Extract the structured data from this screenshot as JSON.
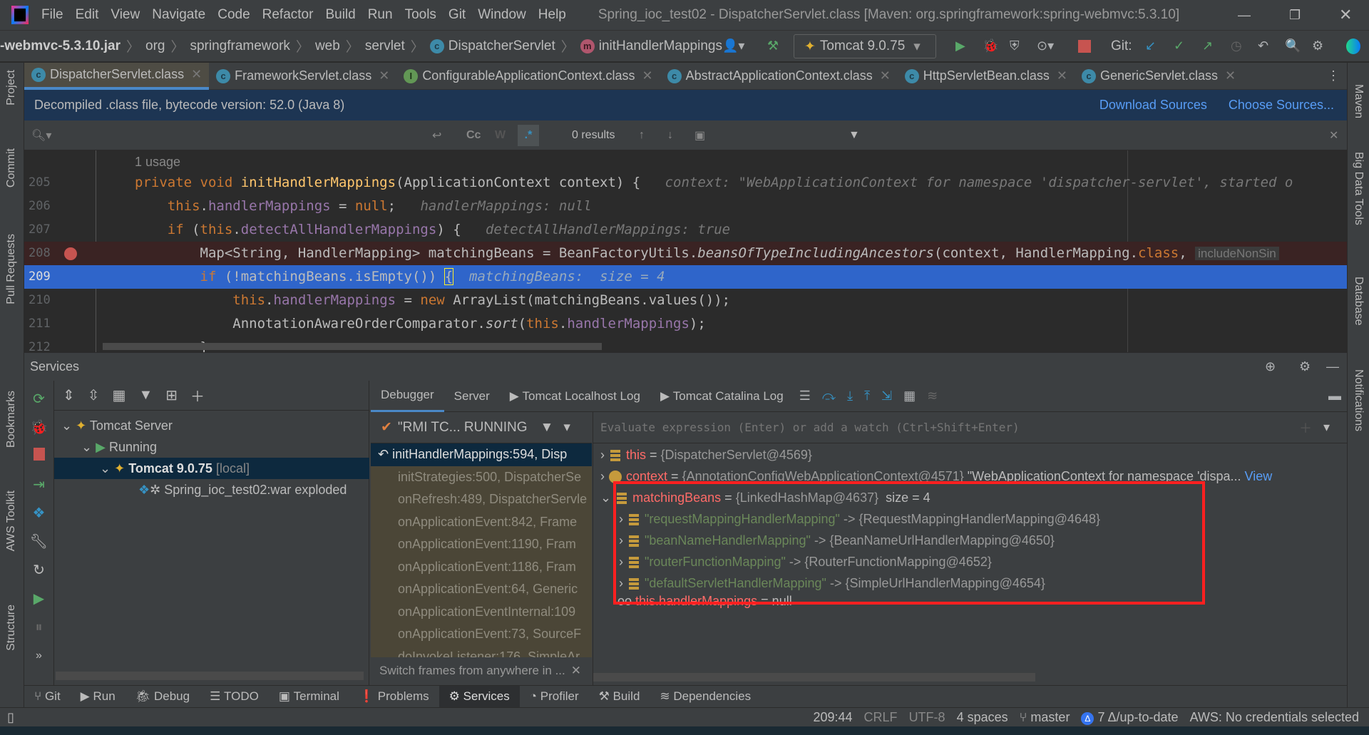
{
  "menu": [
    "File",
    "Edit",
    "View",
    "Navigate",
    "Code",
    "Refactor",
    "Build",
    "Run",
    "Tools",
    "Git",
    "Window",
    "Help"
  ],
  "window_title": "Spring_ioc_test02 - DispatcherServlet.class [Maven: org.springframework:spring-webmvc:5.3.10]",
  "breadcrumb": [
    "-webmvc-5.3.10.jar",
    "org",
    "springframework",
    "web",
    "servlet",
    "DispatcherServlet",
    "initHandlerMappings"
  ],
  "run_config": "Tomcat 9.0.75",
  "git_label": "Git:",
  "tabs": [
    {
      "label": "DispatcherServlet.class",
      "icon": "c",
      "active": true
    },
    {
      "label": "FrameworkServlet.class",
      "icon": "c"
    },
    {
      "label": "ConfigurableApplicationContext.class",
      "icon": "i"
    },
    {
      "label": "AbstractApplicationContext.class",
      "icon": "c"
    },
    {
      "label": "HttpServletBean.class",
      "icon": "c"
    },
    {
      "label": "GenericServlet.class",
      "icon": "c"
    }
  ],
  "banner": {
    "text": "Decompiled .class file, bytecode version: 52.0 (Java 8)",
    "download": "Download Sources",
    "choose": "Choose Sources..."
  },
  "search": {
    "results": "0 results",
    "cc": "Cc",
    "w": "W",
    "regex": ".*"
  },
  "code": {
    "usage": "1 usage",
    "lines": [
      {
        "n": "205",
        "hint": "context: \"WebApplicationContext for namespace 'dispatcher-servlet', started o"
      },
      {
        "n": "206",
        "hint": "handlerMappings: null"
      },
      {
        "n": "207",
        "hint": "detectAllHandlerMappings: true"
      },
      {
        "n": "208",
        "hint": "includeNonSin"
      },
      {
        "n": "209",
        "hint": "matchingBeans:  size = 4"
      },
      {
        "n": "210"
      },
      {
        "n": "211"
      },
      {
        "n": "212"
      }
    ]
  },
  "left_strip": [
    "Project",
    "Commit",
    "Pull Requests",
    "Bookmarks",
    "AWS Toolkit",
    "Structure"
  ],
  "right_strip": [
    "Maven",
    "Big Data Tools",
    "Database",
    "Notifications"
  ],
  "services": {
    "title": "Services",
    "tree": [
      {
        "label": "Tomcat Server"
      },
      {
        "label": "Running"
      },
      {
        "label": "Tomcat 9.0.75",
        "suffix": "[local]"
      },
      {
        "label": "Spring_ioc_test02:war exploded"
      }
    ],
    "tabs": [
      "Debugger",
      "Server",
      "Tomcat Localhost Log",
      "Tomcat Catalina Log"
    ],
    "thread": "\"RMI TC... RUNNING",
    "frames": [
      "initHandlerMappings:594, Disp",
      "initStrategies:500, DispatcherSe",
      "onRefresh:489, DispatcherServle",
      "onApplicationEvent:842, Frame",
      "onApplicationEvent:1190, Fram",
      "onApplicationEvent:1186, Fram",
      "onApplicationEvent:64, Generic",
      "onApplicationEventInternal:109",
      "onApplicationEvent:73, SourceF",
      "doInvokeListener:176, SimpleAr"
    ],
    "switch_frames": "Switch frames from anywhere in ...",
    "eval_placeholder": "Evaluate expression (Enter) or add a watch (Ctrl+Shift+Enter)",
    "variables": [
      {
        "name": "this",
        "value": "{DispatcherServlet@4569}"
      },
      {
        "name": "context",
        "value": "{AnnotationConfigWebApplicationContext@4571}",
        "extra": "\"WebApplicationContext for namespace 'dispa...",
        "link": "View"
      },
      {
        "name": "matchingBeans",
        "value": "{LinkedHashMap@4637}",
        "extra": "size = 4"
      },
      {
        "key": "\"requestMappingHandlerMapping\"",
        "value": "-> {RequestMappingHandlerMapping@4648}"
      },
      {
        "key": "\"beanNameHandlerMapping\"",
        "value": "-> {BeanNameUrlHandlerMapping@4650}"
      },
      {
        "key": "\"routerFunctionMapping\"",
        "value": "-> {RouterFunctionMapping@4652}"
      },
      {
        "key": "\"defaultServletHandlerMapping\"",
        "value": "-> {SimpleUrlHandlerMapping@4654}"
      },
      {
        "name": "this.handlerMappings",
        "value": "= null"
      }
    ]
  },
  "bottom_tabs": [
    "Git",
    "Run",
    "Debug",
    "TODO",
    "Terminal",
    "Problems",
    "Services",
    "Profiler",
    "Build",
    "Dependencies"
  ],
  "status": {
    "position": "209:44",
    "line_sep": "CRLF",
    "encoding": "UTF-8",
    "indent": "4 spaces",
    "branch": "master",
    "vcs": "7 Δ/up-to-date",
    "aws": "AWS: No credentials selected"
  },
  "colors": {
    "highlight_box": "#ff2020",
    "selection": "#2f65ca",
    "accent": "#4a88c7"
  }
}
